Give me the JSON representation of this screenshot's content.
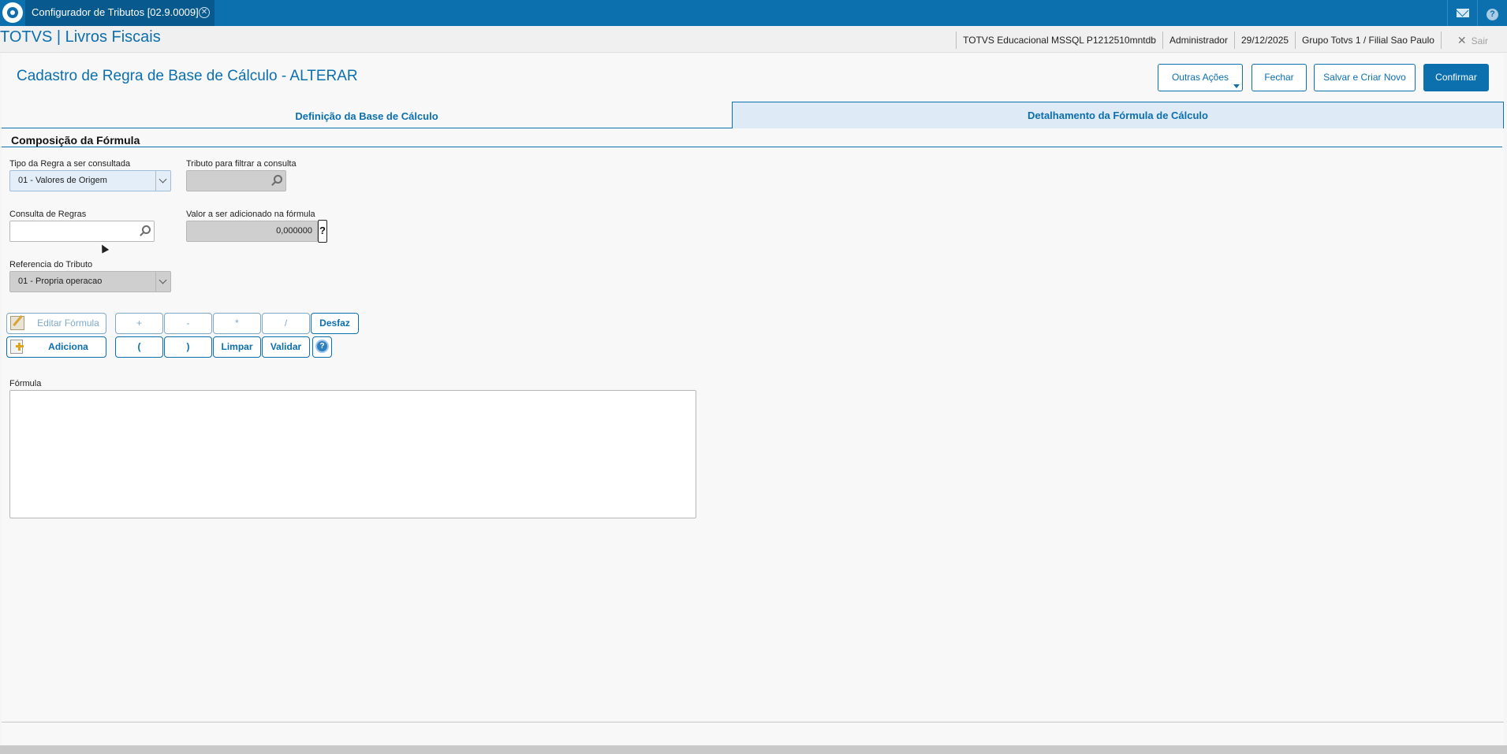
{
  "window": {
    "tab_title": "Configurador de Tributos [02.9.0009]",
    "icons": [
      "totvs-logo-icon",
      "close-icon",
      "mail-icon",
      "help-icon"
    ]
  },
  "header": {
    "brand": "TOTVS | Livros Fiscais",
    "environment": "TOTVS Educacional MSSQL P1212510mntdb",
    "user": "Administrador",
    "date": "29/12/2025",
    "branch": "Grupo Totvs 1 / Filial Sao Paulo",
    "exit_label": "Sair"
  },
  "page": {
    "title": "Cadastro de Regra de Base de Cálculo - ALTERAR",
    "actions": {
      "other_actions": "Outras Ações",
      "close": "Fechar",
      "save_new": "Salvar e Criar Novo",
      "confirm": "Confirmar"
    }
  },
  "tabs": [
    {
      "label": "Definição da Base de Cálculo",
      "active": false
    },
    {
      "label": "Detalhamento da Fórmula de Cálculo",
      "active": true
    }
  ],
  "section": {
    "title": "Composição da Fórmula"
  },
  "form": {
    "rule_type_label": "Tipo da Regra a ser consultada",
    "rule_type_value": "01 - Valores de Origem",
    "tax_filter_label": "Tributo para filtrar a consulta",
    "tax_filter_value": "",
    "rules_query_label": "Consulta de Regras",
    "rules_query_value": "",
    "value_label": "Valor a ser adicionado na fórmula",
    "value_value": "0,000000",
    "value_help": "?",
    "tax_ref_label": "Referencia do Tributo",
    "tax_ref_value": "01 - Propria operacao"
  },
  "formula_buttons": {
    "edit": "Editar Fórmula",
    "add": "Adiciona",
    "plus": "+",
    "minus": "-",
    "multiply": "*",
    "divide": "/",
    "undo": "Desfaz",
    "open_paren": "(",
    "close_paren": ")",
    "clear": "Limpar",
    "validate": "Validar"
  },
  "formula": {
    "label": "Fórmula",
    "value": ""
  },
  "colors": {
    "brand_blue": "#0c6fae",
    "active_tab_bg": "#deeaf5",
    "disabled_field": "#cfcfcf"
  }
}
